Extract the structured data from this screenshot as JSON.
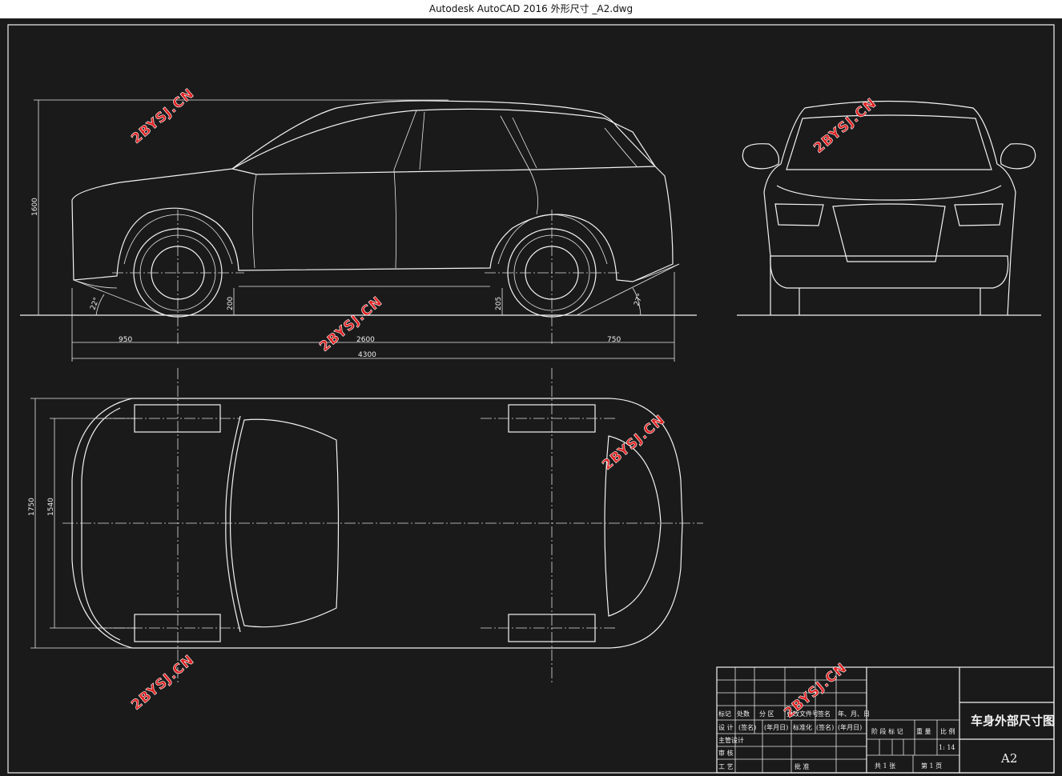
{
  "window": {
    "title": "Autodesk AutoCAD 2016     外形尺寸 _A2.dwg"
  },
  "dimensions": {
    "height": "1600",
    "front_overhang": "950",
    "wheelbase": "2600",
    "rear_overhang": "750",
    "length": "4300",
    "approach_angle": "22°",
    "departure_angle": "27°",
    "clearance_front": "200",
    "clearance_rear": "205",
    "width": "1750",
    "track": "1540"
  },
  "watermark": "2BYSJ.CN",
  "title_block": {
    "drawing_title": "车身外部尺寸图",
    "sheet_size": "A2",
    "scale": "1: 14",
    "row_header": [
      "标记",
      "处数",
      "分 区",
      "更改文件号",
      "签名",
      "年、月、日"
    ],
    "row_design": [
      "设 计",
      "(签名)",
      "(年月日)",
      "标准化",
      "(签名)",
      "(年月日)"
    ],
    "left_labels": [
      "主管设计",
      "审 核",
      "工 艺"
    ],
    "approve": "批 准",
    "stage_headers": [
      "阶 段 标 记",
      "重 量",
      "比 例"
    ],
    "sheets": [
      "共 1 张",
      "第 1 页"
    ]
  },
  "colors": {
    "background": "#1a1a1a",
    "lines": "#f2f2f2",
    "watermark": "#e02020"
  }
}
